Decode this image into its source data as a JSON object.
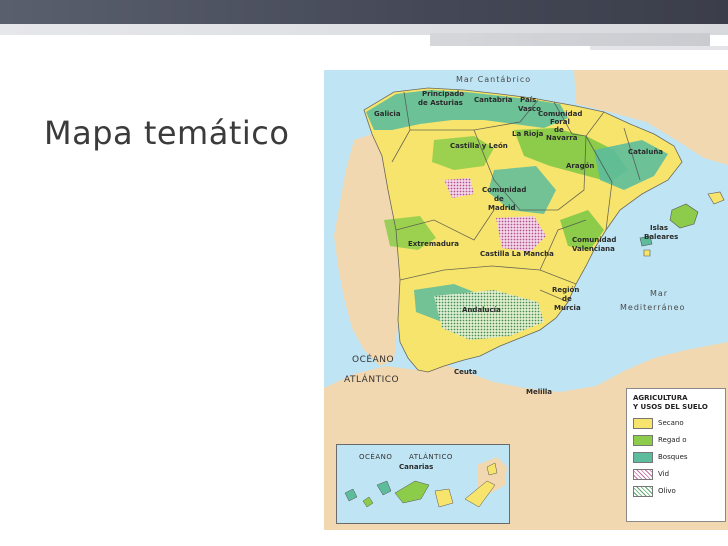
{
  "slide": {
    "title": "Mapa temático"
  },
  "map": {
    "seas": {
      "cantabrico": "Mar Cantábrico",
      "mediterraneo_1": "Mar",
      "mediterraneo_2": "Mediterráneo",
      "oceano_1": "OCÉANO",
      "oceano_2": "ATLÁNTICO"
    },
    "regions": {
      "asturias_1": "Principado",
      "asturias_2": "de Asturias",
      "galicia": "Galicia",
      "cantabria": "Cantabria",
      "pais_vasco_1": "País",
      "pais_vasco_2": "Vasco",
      "navarra_1": "Comunidad",
      "navarra_2": "Foral",
      "navarra_3": "de",
      "navarra_4": "Navarra",
      "la_rioja": "La Rioja",
      "castilla_leon": "Castilla y León",
      "aragon": "Aragón",
      "cataluna": "Cataluña",
      "madrid_1": "Comunidad",
      "madrid_2": "de",
      "madrid_3": "Madrid",
      "extremadura": "Extremadura",
      "castilla_mancha": "Castilla La Mancha",
      "valencia_1": "Comunidad",
      "valencia_2": "Valenciana",
      "baleares_1": "Islas",
      "baleares_2": "Baleares",
      "murcia_1": "Región",
      "murcia_2": "de",
      "murcia_3": "Murcia",
      "andalucia": "Andalucía",
      "ceuta": "Ceuta",
      "melilla": "Melilla"
    },
    "inset": {
      "oceano": "OCÉANO",
      "atlantico": "ATLÁNTICO",
      "canarias": "Canarias"
    },
    "legend": {
      "title_1": "AGRICULTURA",
      "title_2": "Y USOS DEL SUELO",
      "items": [
        {
          "label": "Secano",
          "color": "#f7e46c"
        },
        {
          "label": "Regad o",
          "color": "#8ccc4a"
        },
        {
          "label": "Bosques",
          "color": "#5cbc9c"
        },
        {
          "label": "Vid",
          "color": "#c46fa8"
        },
        {
          "label": "Olivo",
          "color": "#5aa86a"
        }
      ]
    }
  }
}
